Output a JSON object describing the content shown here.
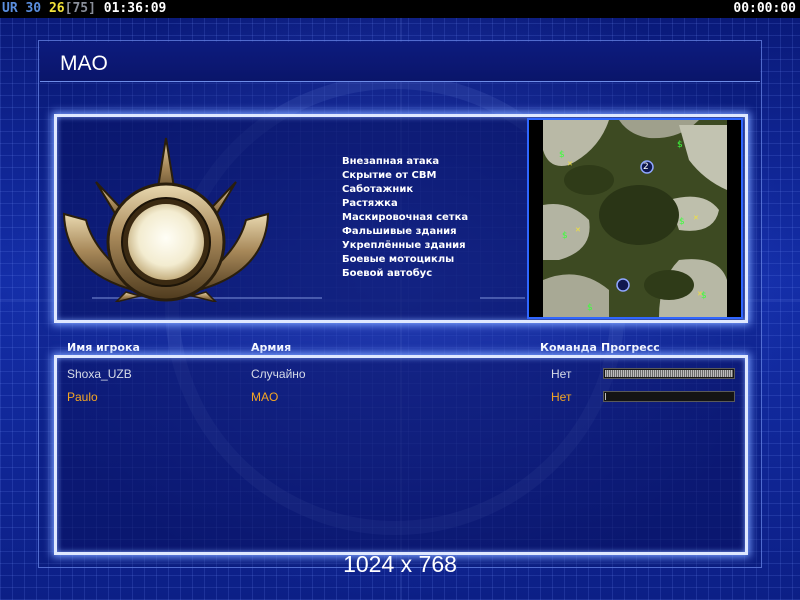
{
  "status_bar": {
    "ur_label": "UR",
    "ur_value": "30",
    "fps_value": "26",
    "bracket_value": "[75]",
    "elapsed_time": "01:36:09",
    "countdown": "00:00:00"
  },
  "title": "MAO",
  "army": {
    "emblem_icon": "mao-faction-emblem-icon",
    "abilities": [
      "Внезапная атака",
      "Скрытие от СВМ",
      "Саботажник",
      "Растяжка",
      "Маскировочная сетка",
      "Фальшивые здания",
      "Укреплённые здания",
      "Боевые мотоциклы",
      "Боевой автобус"
    ]
  },
  "minimap": {
    "start_position_label": "2"
  },
  "players_table": {
    "headers": {
      "name": "Имя игрока",
      "army": "Армия",
      "team": "Команда",
      "progress": "Прогресс"
    },
    "rows": [
      {
        "name": "Shoxa_UZB",
        "army": "Случайно",
        "team": "Нет",
        "progress": 1.0,
        "local": false
      },
      {
        "name": "Paulo",
        "army": "MAO",
        "team": "Нет",
        "progress": 0.01,
        "local": true
      }
    ]
  },
  "resolution": "1024 x 768",
  "colors": {
    "local_player": "#f5a623",
    "panel_border": "#dfe8ff",
    "background": "#142ea8",
    "minimap_border": "#2f66ff"
  }
}
